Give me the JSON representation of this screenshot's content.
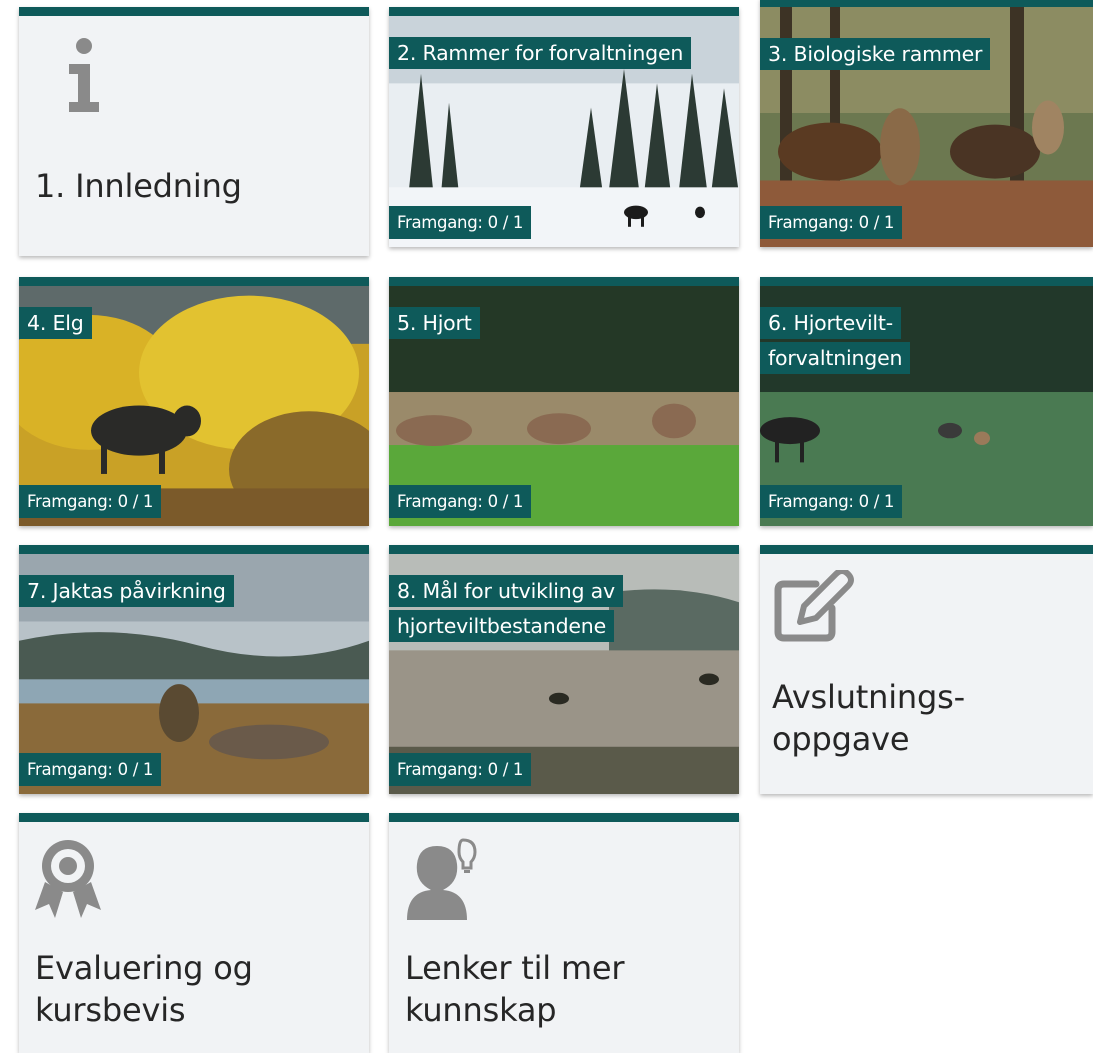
{
  "tiles": [
    {
      "title": "1. Innledning",
      "icon": "info-icon"
    },
    {
      "title": "2. Rammer for forvaltningen",
      "progress": "Framgang: 0 / 1"
    },
    {
      "title": "3. Biologiske rammer",
      "progress": "Framgang: 0 / 1"
    },
    {
      "title": "4. Elg",
      "progress": "Framgang: 0 / 1"
    },
    {
      "title": "5. Hjort",
      "progress": "Framgang: 0 / 1"
    },
    {
      "title": "6. Hjortevilt-forvaltningen",
      "progress": "Framgang: 0 / 1"
    },
    {
      "title": "7. Jaktas påvirkning",
      "progress": "Framgang: 0 / 1"
    },
    {
      "title": "8. Mål for utvikling av hjorteviltbestandene",
      "progress": "Framgang: 0 / 1"
    },
    {
      "title_line1": "Avslutnings-",
      "title_line2": "oppgave",
      "icon": "edit-icon"
    },
    {
      "title_line1": "Evaluering og",
      "title_line2": "kursbevis",
      "icon": "award-icon"
    },
    {
      "title_line1": "Lenker til mer",
      "title_line2": "kunnskap",
      "icon": "user-idea-icon"
    }
  ],
  "colors": {
    "accent": "#0e5a5a",
    "tile_bg": "#f1f3f5",
    "icon_gray": "#8a8a8a"
  }
}
